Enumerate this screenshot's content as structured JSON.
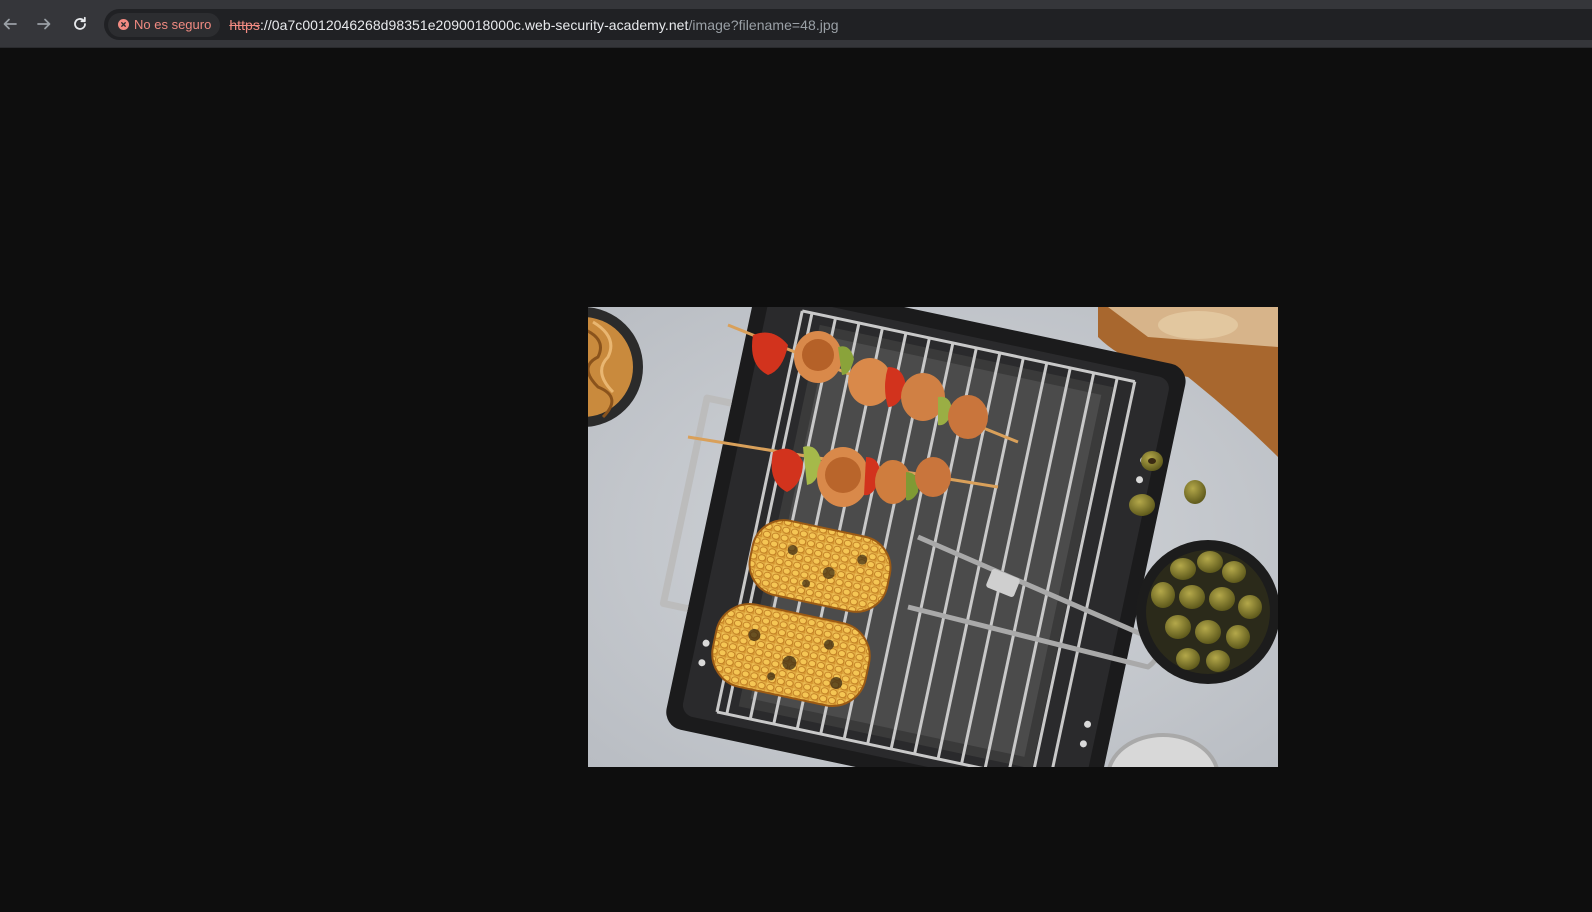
{
  "browser": {
    "nav": {
      "back_icon": "arrow-left-icon",
      "forward_icon": "arrow-right-icon",
      "reload_icon": "reload-icon"
    },
    "security": {
      "label": "No es seguro",
      "icon": "not-secure-icon",
      "color": "#f28b82"
    },
    "url": {
      "scheme": "https",
      "separator": "://",
      "host": "0a7c0012046268d98351e2090018000c.web-security-academy.net",
      "path": "/image?filename=48.jpg"
    }
  },
  "page": {
    "background": "#0e0e0e",
    "image": {
      "subject": "grill-with-skewers-and-corn-photo"
    }
  }
}
